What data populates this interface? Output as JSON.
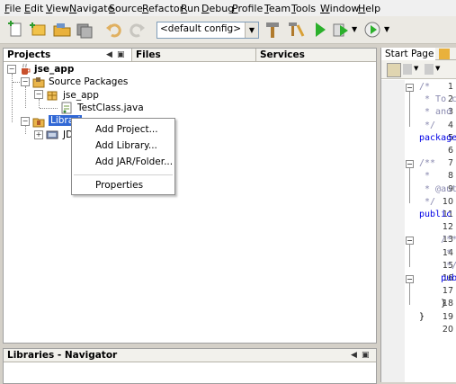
{
  "menu": [
    "File",
    "Edit",
    "View",
    "Navigate",
    "Source",
    "Refactor",
    "Run",
    "Debug",
    "Profile",
    "Team",
    "Tools",
    "Window",
    "Help"
  ],
  "toolbar": {
    "config_value": "<default config>",
    "buttons": [
      "new-file-icon",
      "new-project-icon",
      "open-project-icon",
      "save-all-icon",
      "undo-icon",
      "redo-icon",
      "clean-build-icon",
      "build-icon",
      "run-icon",
      "debug-icon",
      "profile-icon"
    ]
  },
  "tabs": {
    "projects": "Projects",
    "files": "Files",
    "services": "Services",
    "start_page": "Start Page"
  },
  "tree": {
    "project": "jse_app",
    "source_packages": "Source Packages",
    "package": "jse_app",
    "file": "TestClass.java",
    "libraries": "Librari",
    "jdk": "JD"
  },
  "context_menu": {
    "items": [
      "Add Project...",
      "Add Library...",
      "Add JAR/Folder...",
      "Properties"
    ]
  },
  "navigator": {
    "title": "Libraries - Navigator"
  },
  "editor": {
    "line_numbers": [
      "1",
      "2",
      "3",
      "4",
      "5",
      "6",
      "7",
      "8",
      "9",
      "10",
      "11",
      "12",
      "13",
      "14",
      "15",
      "16",
      "17",
      "18",
      "19",
      "20"
    ],
    "lines": [
      "/*",
      " * To c",
      " * and",
      " */",
      "package",
      "",
      "/**",
      " *",
      " * @aut",
      " */",
      "public",
      "",
      "    /**",
      "     *",
      "     */",
      "    pub",
      "",
      "    }",
      "}",
      ""
    ]
  },
  "colors": {
    "selection": "#3168d5",
    "chrome": "#ebe9e3",
    "keyword": "#0000e6",
    "comment": "#8a8ab0"
  }
}
